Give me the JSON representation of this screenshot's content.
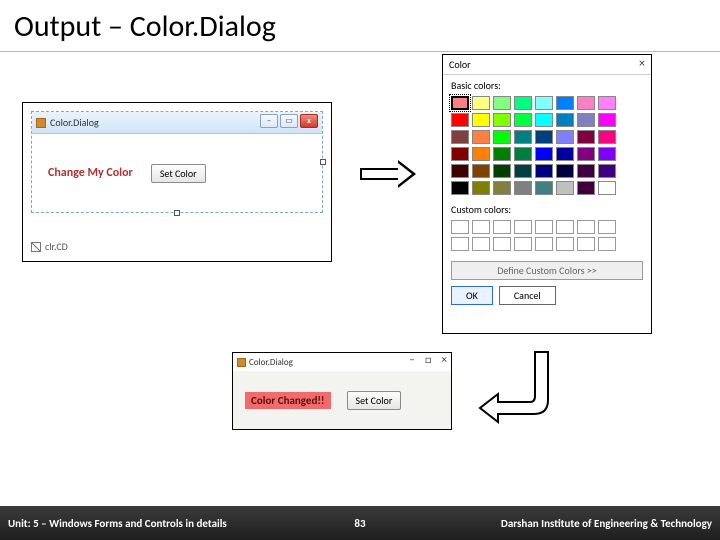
{
  "title": "Output – Color.Dialog",
  "win1": {
    "title": "Color.Dialog",
    "label": "Change My Color",
    "button": "Set Color",
    "status": "clr.CD"
  },
  "color_dialog": {
    "title": "Color",
    "basic_label": "Basic colors:",
    "custom_label": "Custom colors:",
    "define": "Define Custom Colors >>",
    "ok": "OK",
    "cancel": "Cancel",
    "basic_colors": [
      "#ff8080",
      "#ffff80",
      "#80ff80",
      "#00ff80",
      "#80ffff",
      "#0080ff",
      "#ff80c0",
      "#ff80ff",
      "#ff0000",
      "#ffff00",
      "#80ff00",
      "#00ff40",
      "#00ffff",
      "#0080c0",
      "#8080c0",
      "#ff00ff",
      "#804040",
      "#ff8040",
      "#00ff00",
      "#008080",
      "#004080",
      "#8080ff",
      "#800040",
      "#ff0080",
      "#800000",
      "#ff8000",
      "#008000",
      "#008040",
      "#0000ff",
      "#0000a0",
      "#800080",
      "#8000ff",
      "#400000",
      "#804000",
      "#004000",
      "#004040",
      "#000080",
      "#000040",
      "#400040",
      "#400080",
      "#000000",
      "#808000",
      "#808040",
      "#808080",
      "#408080",
      "#c0c0c0",
      "#400040",
      "#ffffff"
    ],
    "selected_index": 0,
    "custom_slots": 16
  },
  "win2": {
    "title": "Color.Dialog",
    "label": "Color Changed!!",
    "button": "Set Color"
  },
  "footer": {
    "unit": "Unit: 5 – Windows Forms and Controls in details",
    "page": "83",
    "org": "Darshan Institute of Engineering & Technology"
  }
}
